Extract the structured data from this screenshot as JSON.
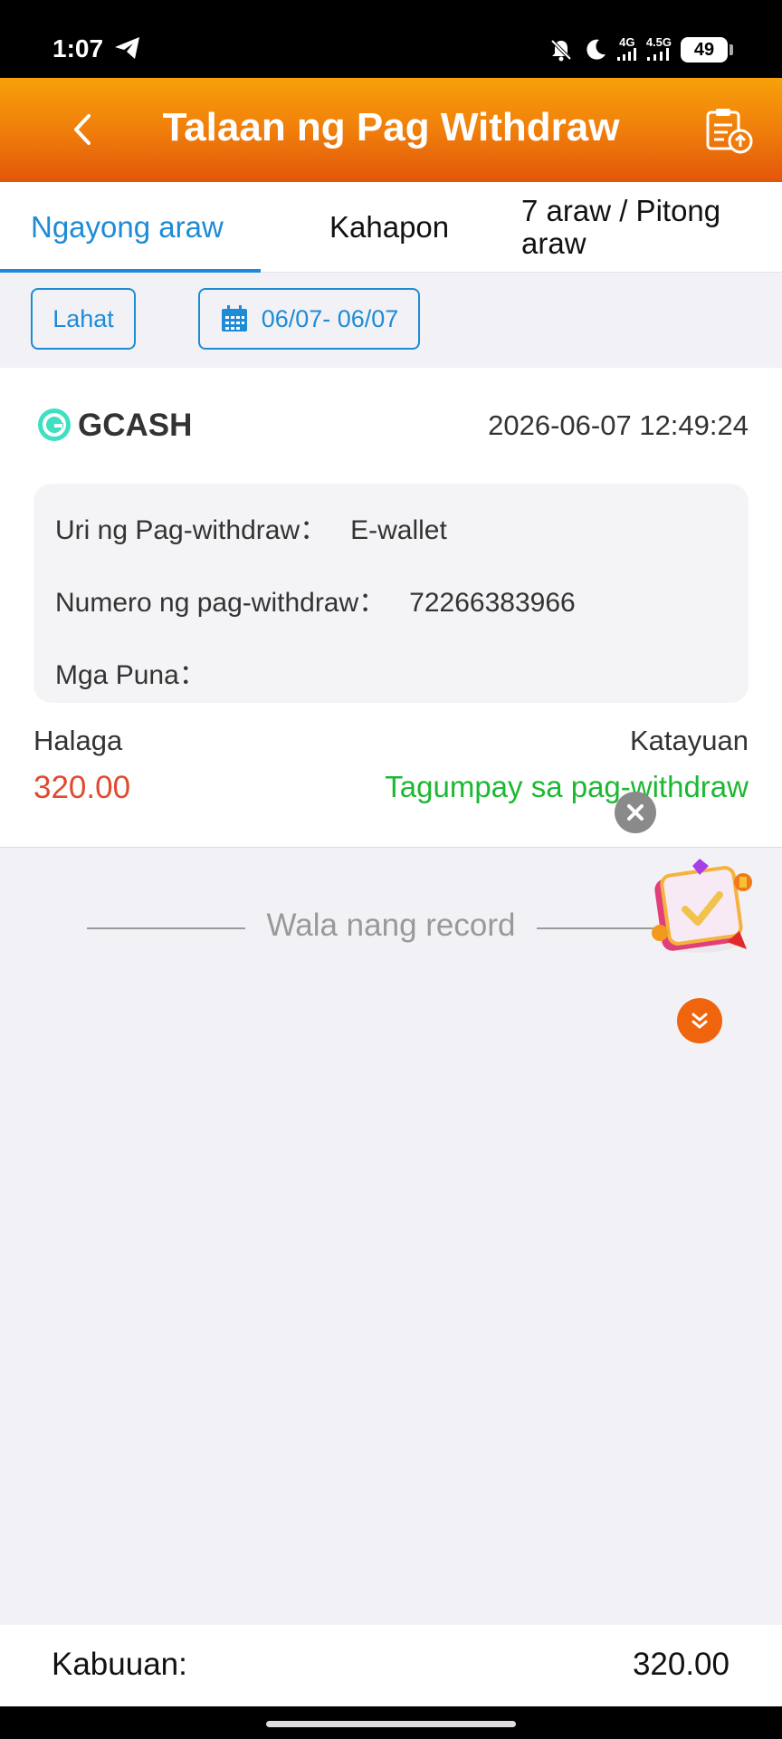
{
  "status_bar": {
    "time": "1:07",
    "network_1": "4G",
    "network_2": "4.5G",
    "battery": "49"
  },
  "header": {
    "title": "Talaan ng Pag Withdraw",
    "back_icon": "chevron-left-icon",
    "upload_icon": "clipboard-upload-icon"
  },
  "tabs": [
    {
      "label": "Ngayong araw",
      "active": true
    },
    {
      "label": "Kahapon",
      "active": false
    },
    {
      "label": "7 araw / Pitong araw",
      "active": false
    }
  ],
  "filters": {
    "all_label": "Lahat",
    "date_range": "06/07- 06/07"
  },
  "record": {
    "method": "GCASH",
    "timestamp": "2026-06-07 12:49:24",
    "type_label": "Uri ng Pag-withdraw：",
    "type_value": "E-wallet",
    "number_label": "Numero ng pag-withdraw：",
    "number_value": "72266383966",
    "remarks_label": "Mga Puna：",
    "remarks_value": "",
    "amount_label": "Halaga",
    "amount_value": "320.00",
    "status_label": "Katayuan",
    "status_value": "Tagumpay sa pag-withdraw"
  },
  "empty_state": "Wala nang record",
  "footer": {
    "total_label": "Kabuuan:",
    "total_value": "320.00"
  },
  "colors": {
    "accent_blue": "#1e8bd6",
    "header_orange": "#ef7b0b",
    "amount_red": "#e14a2f",
    "success_green": "#1db832"
  }
}
